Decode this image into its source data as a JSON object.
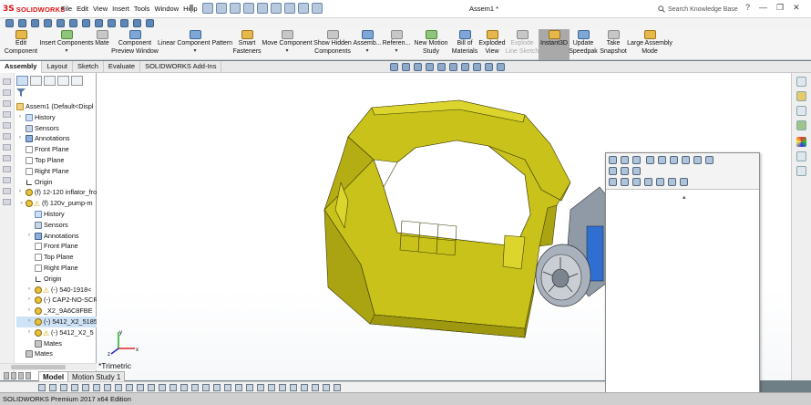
{
  "app": {
    "brand_ds": "3S",
    "brand_name": "SOLIDWORKS",
    "document_title": "Assem1 *",
    "search_placeholder": "Search Knowledge Base"
  },
  "menu": [
    "File",
    "Edit",
    "View",
    "Insert",
    "Tools",
    "Window",
    "Help"
  ],
  "window_controls": [
    "?",
    "—",
    "❐",
    "✕"
  ],
  "commands": [
    {
      "line1": "Edit",
      "line2": "Component",
      "icon": "edit-component-icon"
    },
    {
      "line1": "Insert Components",
      "line2": "▾",
      "icon": "insert-components-icon"
    },
    {
      "line1": "Mate",
      "line2": "",
      "icon": "mate-icon"
    },
    {
      "line1": "Component",
      "line2": "Preview Window",
      "icon": "component-preview-icon"
    },
    {
      "line1": "Linear Component Pattern",
      "line2": "▾",
      "icon": "linear-pattern-icon"
    },
    {
      "line1": "Smart",
      "line2": "Fasteners",
      "icon": "smart-fasteners-icon"
    },
    {
      "line1": "Move Component",
      "line2": "▾",
      "icon": "move-component-icon"
    },
    {
      "line1": "Show Hidden",
      "line2": "Components",
      "icon": "show-hidden-icon"
    },
    {
      "line1": "Assemb...",
      "line2": "▾",
      "icon": "assembly-features-icon"
    },
    {
      "line1": "Referen...",
      "line2": "▾",
      "icon": "reference-geometry-icon"
    },
    {
      "line1": "New Motion",
      "line2": "Study",
      "icon": "motion-study-icon"
    },
    {
      "line1": "Bill of",
      "line2": "Materials",
      "icon": "bom-icon"
    },
    {
      "line1": "Exploded",
      "line2": "View",
      "icon": "exploded-view-icon"
    },
    {
      "line1": "Explode",
      "line2": "Line Sketch",
      "icon": "explode-line-icon"
    },
    {
      "line1": "Instant3D",
      "line2": "",
      "icon": "instant3d-icon"
    },
    {
      "line1": "Update",
      "line2": "Speedpak",
      "icon": "speedpak-icon"
    },
    {
      "line1": "Take",
      "line2": "Snapshot",
      "icon": "snapshot-icon"
    },
    {
      "line1": "Large Assembly",
      "line2": "Mode",
      "icon": "large-assembly-icon"
    }
  ],
  "tabs": [
    "Assembly",
    "Layout",
    "Sketch",
    "Evaluate",
    "SOLIDWORKS Add-Ins"
  ],
  "active_tab": "Assembly",
  "tree": [
    {
      "label": "Assem1  (Default<Displ",
      "icon": "assembly-icon",
      "level": 0,
      "expander": ""
    },
    {
      "label": "History",
      "icon": "history-icon",
      "level": 1,
      "expander": "›"
    },
    {
      "label": "Sensors",
      "icon": "sensor-icon",
      "level": 1,
      "expander": ""
    },
    {
      "label": "Annotations",
      "icon": "annotations-icon",
      "level": 1,
      "expander": "›"
    },
    {
      "label": "Front Plane",
      "icon": "plane-icon",
      "level": 1,
      "expander": ""
    },
    {
      "label": "Top Plane",
      "icon": "plane-icon",
      "level": 1,
      "expander": ""
    },
    {
      "label": "Right Plane",
      "icon": "plane-icon",
      "level": 1,
      "expander": ""
    },
    {
      "label": "Origin",
      "icon": "origin-icon",
      "level": 1,
      "expander": ""
    },
    {
      "label": "(f) 12-120 inflator_fro",
      "icon": "part-icon",
      "level": 1,
      "expander": "›"
    },
    {
      "label": "(f) 120v_pump-m",
      "icon": "warning-part-icon",
      "level": 1,
      "expander": "⌄"
    },
    {
      "label": "History",
      "icon": "history-icon",
      "level": 2,
      "expander": ""
    },
    {
      "label": "Sensors",
      "icon": "sensor-icon",
      "level": 2,
      "expander": ""
    },
    {
      "label": "Annotations",
      "icon": "annotations-icon",
      "level": 2,
      "expander": "›"
    },
    {
      "label": "Front Plane",
      "icon": "plane-icon",
      "level": 2,
      "expander": ""
    },
    {
      "label": "Top Plane",
      "icon": "plane-icon",
      "level": 2,
      "expander": ""
    },
    {
      "label": "Right Plane",
      "icon": "plane-icon",
      "level": 2,
      "expander": ""
    },
    {
      "label": "Origin",
      "icon": "origin-icon",
      "level": 2,
      "expander": ""
    },
    {
      "label": "(-) 540-1918<",
      "icon": "warning-part-icon",
      "level": 2,
      "expander": "›"
    },
    {
      "label": "(-) CAP2-NO-SCR",
      "icon": "part-icon",
      "level": 2,
      "expander": "›"
    },
    {
      "label": "_X2_9A6C8FBE",
      "icon": "part-icon",
      "level": 2,
      "expander": "›"
    },
    {
      "label": "(-) 5412_X2_5185",
      "icon": "part-icon",
      "level": 2,
      "expander": "›",
      "selected": true
    },
    {
      "label": "(-) 5412_X2_5",
      "icon": "warning-part-icon",
      "level": 2,
      "expander": "›"
    },
    {
      "label": "Mates",
      "icon": "mates-icon",
      "level": 2,
      "expander": ""
    },
    {
      "label": "Mates",
      "icon": "mates-icon",
      "level": 1,
      "expander": ""
    }
  ],
  "viewport": {
    "view_label": "*Trimetric",
    "triad_axes": [
      "x",
      "y",
      "z"
    ]
  },
  "bottom_tabs": [
    "Model",
    "Motion Study 1"
  ],
  "status": "SOLIDWORKS Premium 2017 x64 Edition",
  "colors": {
    "model_yellow": "#c8c21a",
    "model_edge": "#3c3a08",
    "selection_blue": "#cfe3f7",
    "brand_red": "#d11111"
  }
}
